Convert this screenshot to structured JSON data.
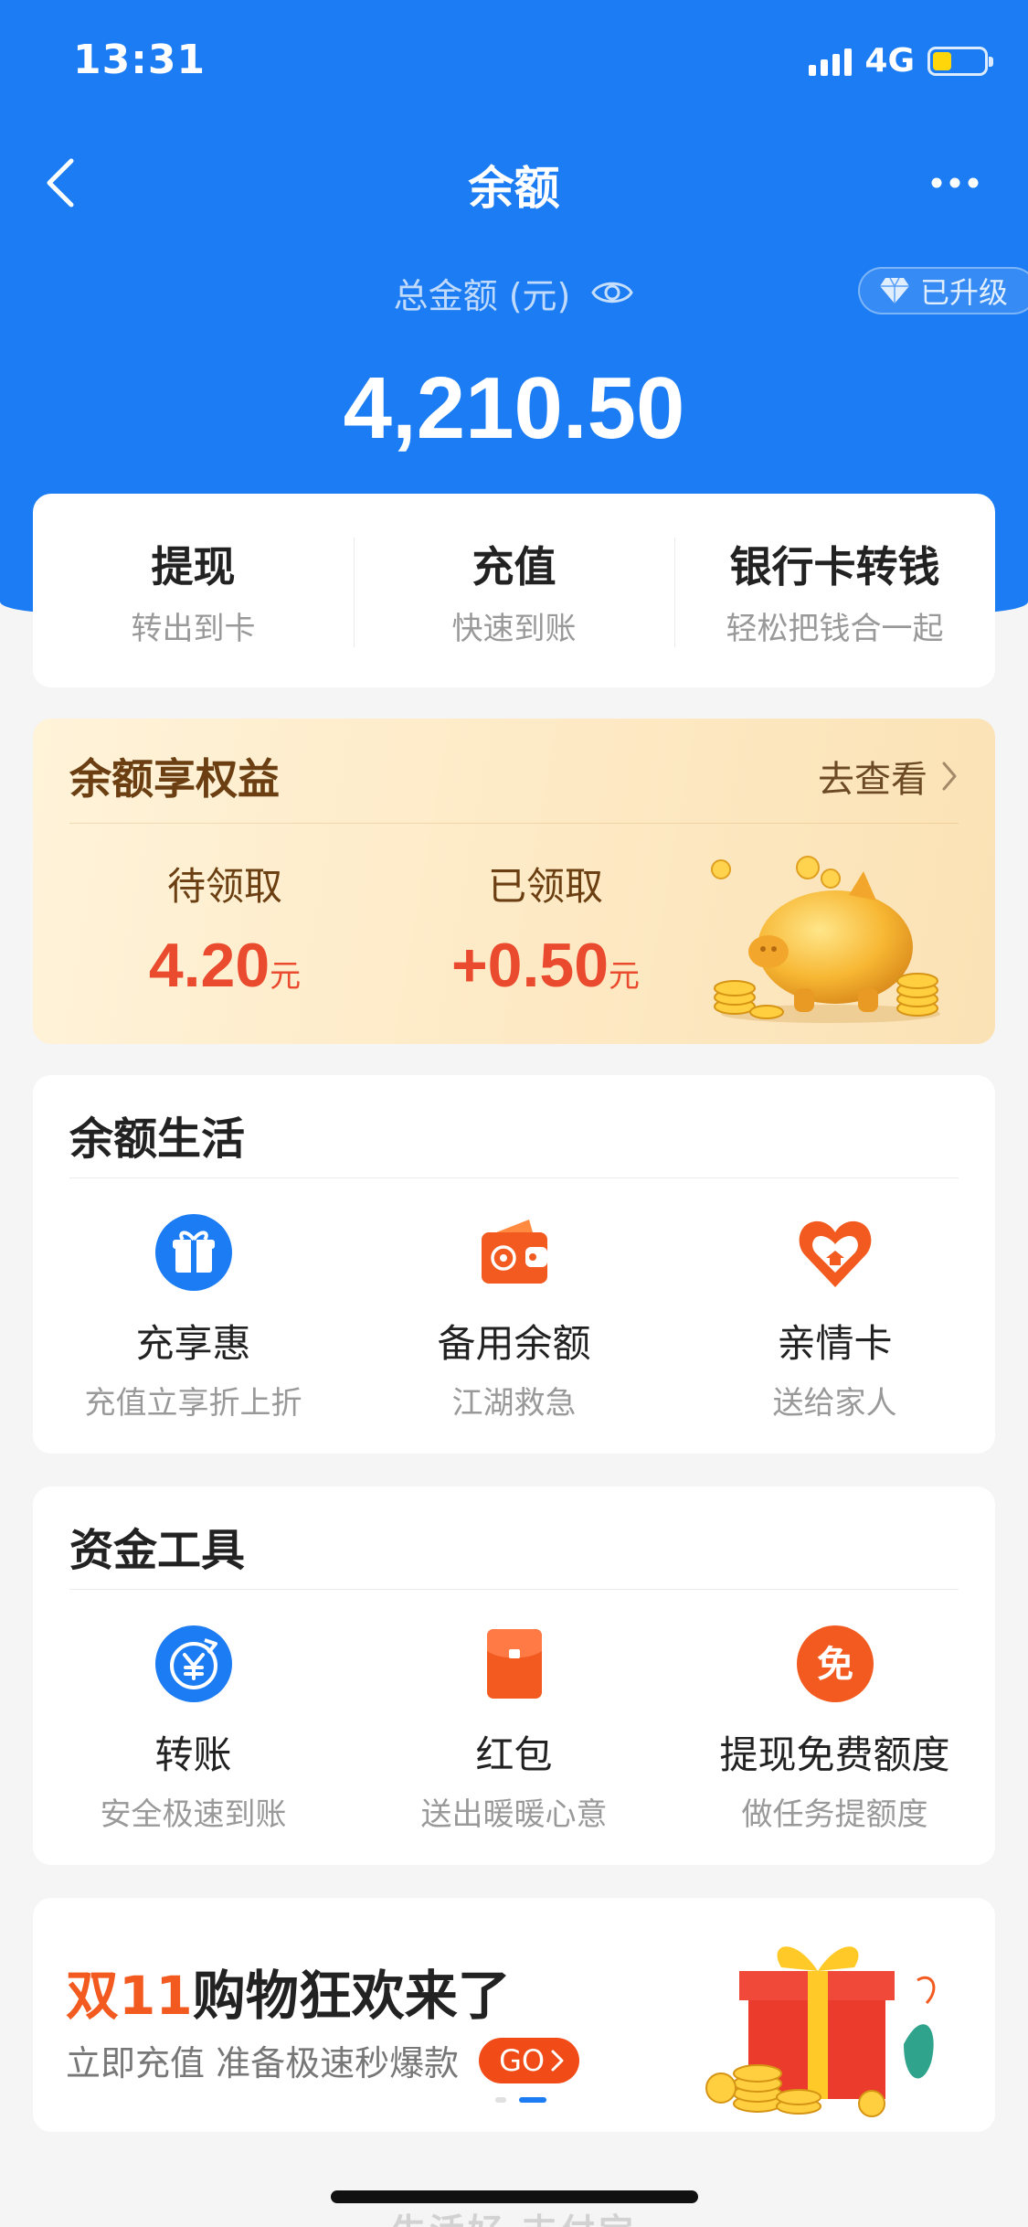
{
  "status_bar": {
    "time": "13:31",
    "network": "4G"
  },
  "nav": {
    "title": "余额"
  },
  "balance": {
    "total_label": "总金额 (元)",
    "amount": "4,210.50",
    "upgrade_badge": "已升级"
  },
  "actions": [
    {
      "title": "提现",
      "subtitle": "转出到卡"
    },
    {
      "title": "充值",
      "subtitle": "快速到账"
    },
    {
      "title": "银行卡转钱",
      "subtitle": "轻松把钱合一起"
    }
  ],
  "rights": {
    "title": "余额享权益",
    "link": "去查看",
    "pending": {
      "label": "待领取",
      "value": "4.20",
      "unit": "元"
    },
    "received": {
      "label": "已领取",
      "value": "+0.50",
      "unit": "元"
    }
  },
  "life": {
    "title": "余额生活",
    "items": [
      {
        "title": "充享惠",
        "subtitle": "充值立享折上折",
        "icon": "gift-icon"
      },
      {
        "title": "备用余额",
        "subtitle": "江湖救急",
        "icon": "wallet-icon"
      },
      {
        "title": "亲情卡",
        "subtitle": "送给家人",
        "icon": "heart-home-icon"
      }
    ]
  },
  "tools": {
    "title": "资金工具",
    "items": [
      {
        "title": "转账",
        "subtitle": "安全极速到账",
        "icon": "transfer-yuan-icon"
      },
      {
        "title": "红包",
        "subtitle": "送出暖暖心意",
        "icon": "red-envelope-icon"
      },
      {
        "title": "提现免费额度",
        "subtitle": "做任务提额度",
        "icon": "free-badge-icon",
        "icon_text": "免"
      }
    ]
  },
  "banner": {
    "title_highlight": "双11",
    "title_rest": "购物狂欢来了",
    "subtitle": "立即充值 准备极速秒爆款",
    "cta": "GO"
  },
  "footer_watermark": "生活好 支付宝",
  "colors": {
    "brand_blue": "#1b7cf3",
    "accent_red": "#ea4a2d",
    "accent_orange": "#f25a1f",
    "gold_text": "#6b3f12"
  }
}
